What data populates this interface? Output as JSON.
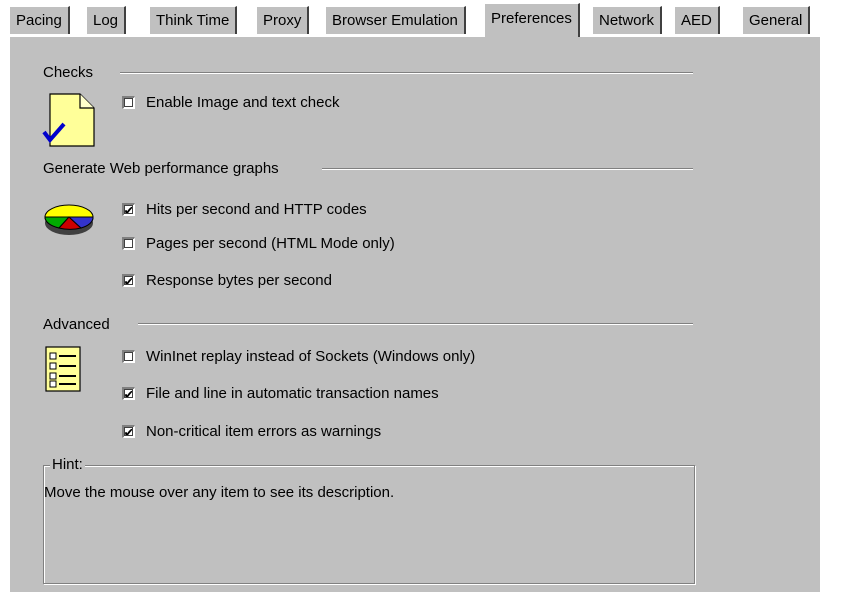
{
  "tabs": [
    {
      "label": "Pacing",
      "active": false
    },
    {
      "label": "Log",
      "active": false
    },
    {
      "label": "Think Time",
      "active": false
    },
    {
      "label": "Proxy",
      "active": false
    },
    {
      "label": "Browser Emulation",
      "active": false
    },
    {
      "label": "Preferences",
      "active": true
    },
    {
      "label": "Network",
      "active": false
    },
    {
      "label": "AED",
      "active": false
    },
    {
      "label": "General",
      "active": false
    }
  ],
  "checks": {
    "title": "Checks",
    "icon": "document-check-icon",
    "items": [
      {
        "label": "Enable Image and text check",
        "checked": false
      }
    ]
  },
  "graphs": {
    "title": "Generate Web performance graphs",
    "icon": "pie-chart-icon",
    "items": [
      {
        "label": "Hits per second and HTTP codes",
        "checked": true
      },
      {
        "label": "Pages per second (HTML Mode only)",
        "checked": false
      },
      {
        "label": "Response bytes per second",
        "checked": true
      }
    ]
  },
  "advanced": {
    "title": "Advanced",
    "icon": "checklist-icon",
    "items": [
      {
        "label": "WinInet replay instead of Sockets (Windows only)",
        "checked": false
      },
      {
        "label": "File and line in automatic transaction names",
        "checked": true
      },
      {
        "label": "Non-critical item errors as warnings",
        "checked": true
      }
    ]
  },
  "hint": {
    "title": "Hint:",
    "text": "Move the mouse over any item to see its description."
  },
  "colors": {
    "dialog_bg": "#c0c0c0",
    "icon_yellow": "#ffff99",
    "check_blue": "#0000cc"
  }
}
